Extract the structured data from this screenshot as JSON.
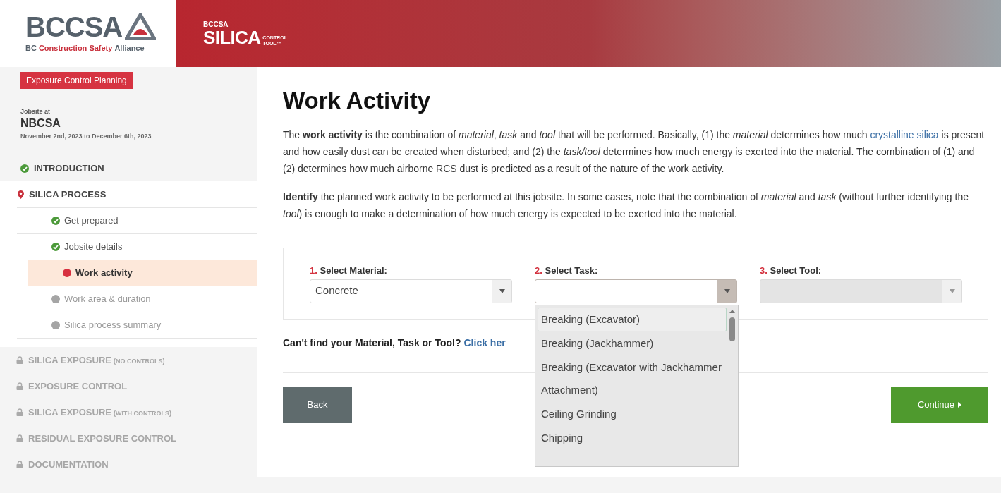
{
  "header": {
    "logo": {
      "name": "BCCSA",
      "tagline_parts": [
        {
          "text": "BC",
          "accent": false
        },
        {
          "text": "Construction Safety",
          "accent": true
        },
        {
          "text": "Alliance",
          "accent": false
        }
      ]
    },
    "banner": {
      "brand": "BCCSA",
      "product": "SILICA",
      "product_sub": [
        "CONTROL",
        "TOOL™"
      ]
    }
  },
  "sidebar": {
    "badge": "Exposure Control Planning",
    "jobsite_label": "Jobsite at",
    "jobsite_name": "NBCSA",
    "dates": "November 2nd, 2023 to December 6th, 2023",
    "sections": [
      {
        "label": "INTRODUCTION",
        "kind": "done"
      },
      {
        "label": "SILICA PROCESS",
        "kind": "current",
        "expanded": true,
        "children": [
          {
            "label": "Get prepared",
            "kind": "done",
            "selected": false
          },
          {
            "label": "Jobsite details",
            "kind": "done",
            "selected": false
          },
          {
            "label": "Work activity",
            "kind": "current",
            "selected": true
          },
          {
            "label": "Work area & duration",
            "kind": "pending",
            "selected": false
          },
          {
            "label": "Silica process summary",
            "kind": "pending",
            "selected": false
          }
        ]
      },
      {
        "label": "SILICA EXPOSURE",
        "note": "(NO CONTROLS)",
        "kind": "locked"
      },
      {
        "label": "EXPOSURE CONTROL",
        "kind": "locked"
      },
      {
        "label": "SILICA EXPOSURE",
        "note": "(WITH CONTROLS)",
        "kind": "locked"
      },
      {
        "label": "RESIDUAL EXPOSURE CONTROL",
        "kind": "locked"
      },
      {
        "label": "DOCUMENTATION",
        "kind": "locked"
      }
    ]
  },
  "main": {
    "title": "Work Activity",
    "paragraphs": [
      [
        {
          "kind": "text",
          "text": "The **work activity** is the combination of *material*, *task* and *tool* that will be performed. Basically, (1) the *material* determines how much "
        },
        {
          "kind": "link",
          "text": "crystalline silica"
        },
        {
          "kind": "text",
          "text": " is present and how easily dust can be created when disturbed; and (2) the *task/tool* determines how much energy is exerted into the material. The combination of (1) and (2) determines how much airborne RCS dust is predicted as a result of the nature of the work activity."
        }
      ],
      [
        {
          "kind": "text",
          "text": "**Identify** the planned work activity to be performed at this jobsite. In some cases, note that the combination of *material* and *task* (without further identifying the *tool*) is enough to make a determination of how much energy is expected to be exerted into the material."
        }
      ]
    ],
    "selects": [
      {
        "number": "1.",
        "label": "Select Material:",
        "value": "Concrete",
        "disabled": false,
        "open": false
      },
      {
        "number": "2.",
        "label": "Select Task:",
        "disabled": false,
        "open": true,
        "options": [
          {
            "label": "Breaking (Excavator)",
            "selected": true
          },
          {
            "label": "Breaking (Jackhammer)",
            "selected": false
          },
          {
            "label": "Breaking (Excavator with Jackhammer Attachment)",
            "selected": false
          },
          {
            "label": "Ceiling Grinding",
            "selected": false
          },
          {
            "label": "Chipping",
            "selected": false
          }
        ]
      },
      {
        "number": "3.",
        "label": "Select Tool:",
        "disabled": true,
        "open": false
      }
    ],
    "help": {
      "question": "Can't find your Material, Task or Tool?",
      "link": "Click her"
    },
    "buttons": [
      {
        "label": "Back",
        "kind": "back"
      },
      {
        "label": "Continue",
        "kind": "continue"
      }
    ]
  }
}
